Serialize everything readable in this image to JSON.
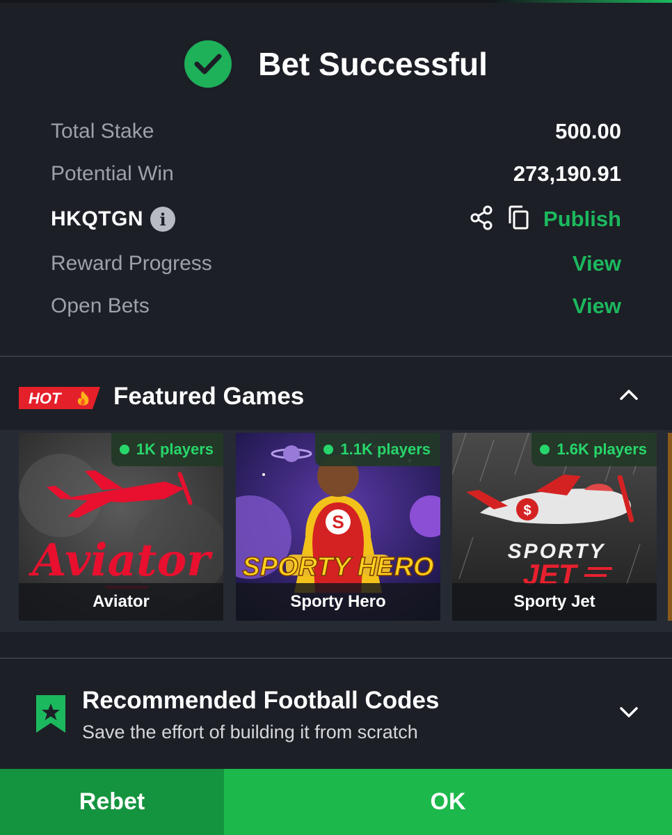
{
  "header": {
    "title": "Bet Successful",
    "icon": "check-circle-icon",
    "accent": "#1eb15a"
  },
  "summary": {
    "total_stake_label": "Total Stake",
    "total_stake_value": "500.00",
    "potential_win_label": "Potential Win",
    "potential_win_value": "273,190.91",
    "booking_code": "HKQTGN",
    "publish_label": "Publish",
    "reward_label": "Reward Progress",
    "reward_link": "View",
    "open_bets_label": "Open Bets",
    "open_bets_link": "View"
  },
  "featured": {
    "badge": "HOT",
    "title": "Featured Games",
    "games": [
      {
        "name": "Aviator",
        "players": "1K players",
        "logo_text": "Aviator"
      },
      {
        "name": "Sporty Hero",
        "players": "1.1K players",
        "logo_text": "SPORTY HERO"
      },
      {
        "name": "Sporty Jet",
        "players": "1.6K players",
        "logo_text_1": "SPORTY",
        "logo_text_2": "JET"
      }
    ]
  },
  "recommended": {
    "title": "Recommended Football Codes",
    "subtitle": "Save the effort of building it from scratch"
  },
  "footer": {
    "rebet_label": "Rebet",
    "ok_label": "OK"
  },
  "colors": {
    "green": "#1cb85e",
    "rebet_bg": "#15943f",
    "ok_bg": "#1cb84c",
    "hot_red": "#e4202b"
  }
}
